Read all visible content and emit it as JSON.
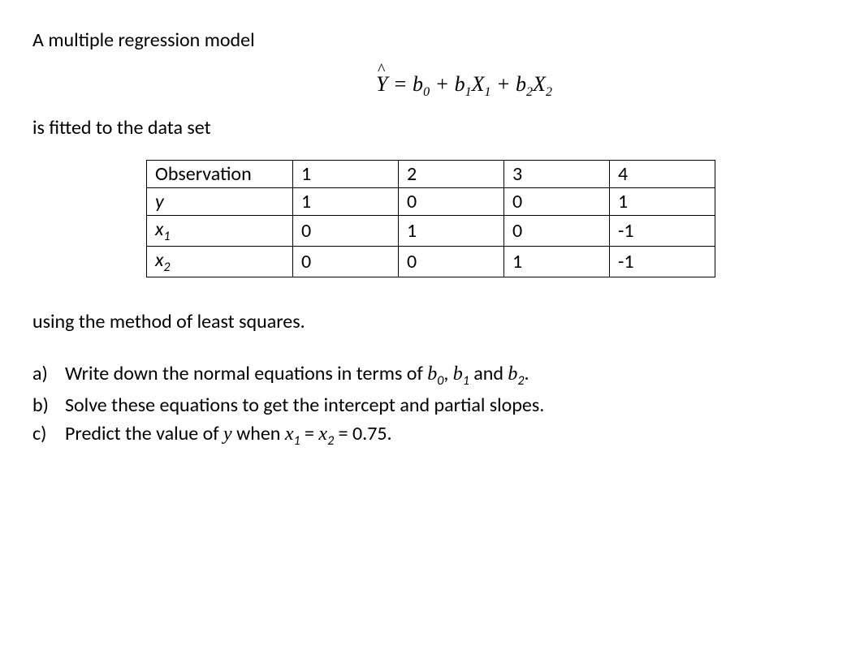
{
  "intro": "A multiple regression model",
  "equation": {
    "yhat": "Y",
    "eq": " = b",
    "s0": "0",
    "plus1": " + b",
    "s1": "1",
    "x1": "X",
    "xs1": "1",
    "plus2": " + b",
    "s2": "2",
    "x2": "X",
    "xs2": "2"
  },
  "fitted": "is fitted to the data set",
  "table": {
    "headers": [
      "Observation",
      "1",
      "2",
      "3",
      "4"
    ],
    "rows": [
      {
        "label": "y",
        "values": [
          "1",
          "0",
          "0",
          "1"
        ]
      },
      {
        "label": "x1",
        "display": "x",
        "sub": "1",
        "values": [
          "0",
          "1",
          "0",
          "-1"
        ]
      },
      {
        "label": "x2",
        "display": "x",
        "sub": "2",
        "values": [
          "0",
          "0",
          "1",
          "-1"
        ]
      }
    ]
  },
  "using": "using the method of least squares.",
  "questions": {
    "a": {
      "letter": "a)",
      "pre": "Write down the normal equations in terms of ",
      "b0": "b",
      "s0": "0",
      "comma": ", ",
      "b1": "b",
      "s1": "1",
      "and": " and ",
      "b2": "b",
      "s2": "2",
      "end": "."
    },
    "b": {
      "letter": "b)",
      "text": "Solve these equations to get the intercept and partial slopes."
    },
    "c": {
      "letter": "c)",
      "pre": "Predict the value of ",
      "y": "y",
      "when": " when ",
      "x1": "x",
      "s1": "1",
      "eq": " = ",
      "x2": "x",
      "s2": "2",
      "val": " = 0.75."
    }
  }
}
